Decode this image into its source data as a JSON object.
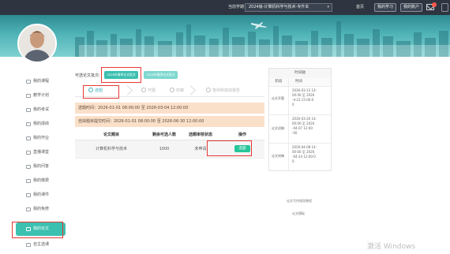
{
  "topbar": {
    "current_term_label": "当前学期",
    "current_term_value": "2024级-计算机科学与技术-专升本",
    "home_label": "首页",
    "my_study_label": "我的学习",
    "my_account_label": "我的账户"
  },
  "sidebar": {
    "items": [
      {
        "label": "我的课程"
      },
      {
        "label": "教学计划"
      },
      {
        "label": "我的考试"
      },
      {
        "label": "我的成绩"
      },
      {
        "label": "我的作业"
      },
      {
        "label": "直播课堂"
      },
      {
        "label": "我的问答"
      },
      {
        "label": "我的缴费"
      },
      {
        "label": "我的课件"
      },
      {
        "label": "我的免修"
      },
      {
        "label": "我的论文"
      },
      {
        "label": "自主选课"
      }
    ],
    "active_index": 10
  },
  "main": {
    "batch_label": "可选论文批次:",
    "batches": [
      {
        "label": "2026年春季论文批次",
        "selected": true
      },
      {
        "label": "2026年春季论文批次",
        "selected": false
      }
    ],
    "steps": [
      {
        "label": "选题",
        "active": true
      },
      {
        "label": "开题",
        "active": false
      },
      {
        "label": "初稿",
        "active": false
      },
      {
        "label": "答辩和成绩报告",
        "active": false
      }
    ],
    "select_period": "选题时间：2026-01-01 08:00:00 至 2026-03-04 12:00:00",
    "self_period": "自拟题目提交时间：2026-01-01 08:00:00 至 2026-06-30 12:00:00",
    "table": {
      "headers": [
        "论文题目",
        "剩余可选人数",
        "选题审核状态",
        "操作"
      ],
      "rows": [
        {
          "title": "计算机科学与技术",
          "remaining": "1000",
          "status": "未申请",
          "action": "选题"
        }
      ]
    }
  },
  "timeline": {
    "title": "时间轴",
    "headers": [
      "阶段",
      "时间"
    ],
    "rows": [
      {
        "stage": "论文开题",
        "time": "2026-03-13 14:\n00:00 至 2026\n-4-23 15:00:0\n0"
      },
      {
        "stage": "论文初稿",
        "time": "2026-03-26 14:\n00:00 至 2026\n-04-07 12:00\n:00"
      },
      {
        "stage": "论文终稿",
        "time": "2026-04-08 14:\n00:00 至 2026\n-04-24 12:00:0\n0"
      }
    ]
  },
  "links": {
    "guide": "论文写作指导教程",
    "template": "论文模板"
  },
  "watermark": "激活 Windows"
}
